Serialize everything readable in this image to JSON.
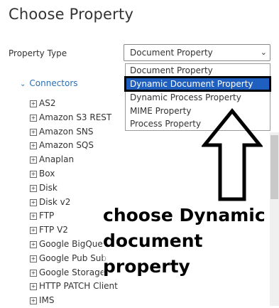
{
  "page": {
    "title": "Choose Property"
  },
  "property_type": {
    "label": "Property Type",
    "selected": "Document Property",
    "options": [
      "Document Property",
      "Dynamic Document Property",
      "Dynamic Process Property",
      "MIME Property",
      "Process Property"
    ],
    "highlighted_index": 1
  },
  "tree": {
    "section": "Connectors",
    "items": [
      "AS2",
      "Amazon S3 REST",
      "Amazon SNS",
      "Amazon SQS",
      "Anaplan",
      "Box",
      "Disk",
      "Disk v2",
      "FTP",
      "FTP V2",
      "Google BigQue",
      "Google Pub Sub",
      "Google Storage",
      "HTTP PATCH Client",
      "IMS"
    ]
  },
  "annotation": {
    "lines": [
      "choose Dynamic",
      "document",
      "property"
    ],
    "colors": {
      "text": "#000000",
      "arrow": "#000000",
      "highlight": "#1e5fbf"
    }
  },
  "icons": {
    "expand": "plus-box-icon",
    "collapse": "chevron-down-icon",
    "dropdown": "caret-down-icon",
    "pointer": "up-arrow-icon"
  }
}
